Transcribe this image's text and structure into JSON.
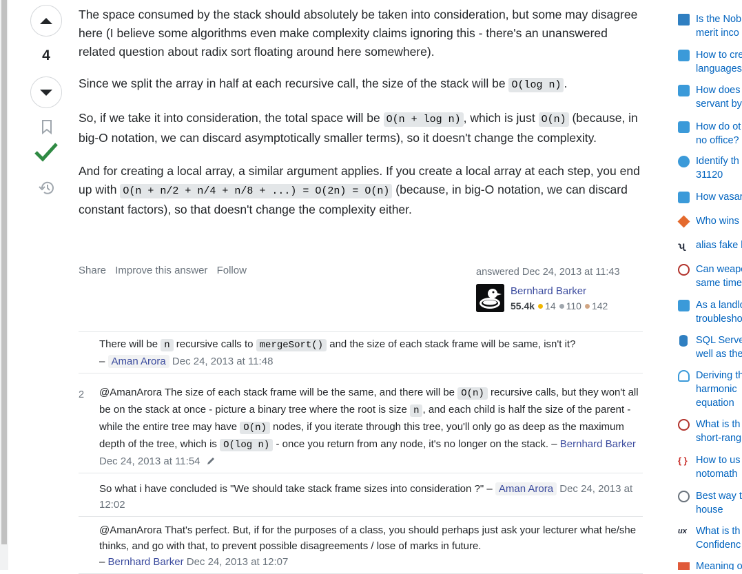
{
  "vote": {
    "score": "4"
  },
  "post": {
    "p1": "The space consumed by the stack should absolutely be taken into consideration, but some may disagree here (I believe some algorithms even make complexity claims ignoring this - there's an unanswered related question about radix sort floating around here somewhere).",
    "p2_a": "Since we split the array in half at each recursive call, the size of the stack will be ",
    "p2_code": "O(log n)",
    "p2_b": ".",
    "p3_a": "So, if we take it into consideration, the total space will be ",
    "p3_code1": "O(n + log n)",
    "p3_b": ", which is just ",
    "p3_code2": "O(n)",
    "p3_c": " (because, in big-O notation, we can discard asymptotically smaller terms), so it doesn't change the complexity.",
    "p4_a": "And for creating a local array, a similar argument applies. If you create a local array at each step, you end up with ",
    "p4_code": "O(n + n/2 + n/4 + n/8 + ...) = O(2n) = O(n)",
    "p4_b": " (because, in big-O notation, we can discard constant factors), so that doesn't change the complexity either."
  },
  "menu": {
    "share": "Share",
    "improve": "Improve this answer",
    "follow": "Follow"
  },
  "signature": {
    "action": "answered Dec 24, 2013 at 11:43",
    "user": "Bernhard Barker",
    "rep": "55.4k",
    "gold": "14",
    "silver": "110",
    "bronze": "142",
    "colors": {
      "gold": "#f1b600",
      "silver": "#9fa6ad",
      "bronze": "#d1a684"
    }
  },
  "comments": [
    {
      "score": "",
      "t1": "There will be ",
      "c1": "n",
      "t2": " recursive calls to ",
      "c2": "mergeSort()",
      "t3": " and the size of each stack frame will be same, isn't it?",
      "dash": " – ",
      "user": "Aman Arora",
      "date": "Dec 24, 2013 at 11:48"
    },
    {
      "score": "2",
      "t1": "@AmanArora The size of each stack frame will be the same, and there will be ",
      "c1": "O(n)",
      "t2": " recursive calls, but they won't all be on the stack at once - picture a binary tree where the root is size ",
      "c2": "n",
      "t3": ", and each child is half the size of the parent - while the entire tree may have ",
      "c3": "O(n)",
      "t4": " nodes, if you iterate through this tree, you'll only go as deep as the maximum depth of the tree, which is ",
      "c4": "O(log n)",
      "t5": " - once you return from any node, it's no longer on the stack.",
      "dash": " – ",
      "user": "Bernhard Barker",
      "date": "Dec 24, 2013 at 11:54"
    },
    {
      "score": "",
      "t1": "So what i have concluded is \"We should take stack frame sizes into consideration ?\"",
      "dash": " – ",
      "user": "Aman Arora",
      "date": "Dec 24, 2013 at 12:02"
    },
    {
      "score": "",
      "t1": "@AmanArora That's perfect. But, if for the purposes of a class, you should perhaps just ask your lecturer what he/she thinks, and go with that, to prevent possible disagreements / lose of marks in future.",
      "dash": "– ",
      "user": "Bernhard Barker",
      "date": "Dec 24, 2013 at 12:07"
    }
  ],
  "sidebar": [
    {
      "text": "Is the Nob",
      "text2": "merit inco",
      "icon": "worldbuilding-icon",
      "color": "#2f7fc1"
    },
    {
      "text": "How to cre",
      "text2": "languages",
      "icon": "softwareengineering-icon",
      "color": "#3b9ad9"
    },
    {
      "text": "How does",
      "text2": "servant by",
      "icon": "politics-icon",
      "color": "#3b9ad9"
    },
    {
      "text": "How do ot",
      "text2": "no office?",
      "icon": "law-icon",
      "color": "#3b9ad9"
    },
    {
      "text": "Identify th",
      "text2": "31120",
      "icon": "puzzling-icon",
      "color": "#3b9ad9"
    },
    {
      "text": "How vasar",
      "text2": "",
      "icon": "hinduism-icon",
      "color": "#3b9ad9"
    },
    {
      "text": "Who wins",
      "text2": "",
      "icon": "boardgames-icon",
      "color": "#e46a2d"
    },
    {
      "text": "alias fake l",
      "text2": "",
      "icon": "unix-icon",
      "color": "#1d2536"
    },
    {
      "text": "Can weapo",
      "text2": "same time",
      "icon": "rpg-icon",
      "color": "#b2332c"
    },
    {
      "text": "As a landlo",
      "text2": "troublesho",
      "icon": "law-icon",
      "color": "#3b9ad9"
    },
    {
      "text": "SQL Serve",
      "text2": "well as the",
      "icon": "dba-icon",
      "color": "#2f7fc1"
    },
    {
      "text": "Deriving th",
      "text2": "harmonic",
      "text3": "equation",
      "icon": "physics-icon",
      "color": "#3b9ad9"
    },
    {
      "text": "What is th",
      "text2": "short-rang",
      "icon": "chemistry-icon",
      "color": "#b2332c"
    },
    {
      "text": "How to us",
      "text2": "notomath",
      "icon": "tex-icon",
      "color": "#c9302c"
    },
    {
      "text": "Best way t",
      "text2": "house",
      "icon": "diy-icon",
      "color": "#6a737c"
    },
    {
      "text": "What is th",
      "text2": "Confidenc",
      "icon": "ux-icon",
      "color": "#1d2536"
    },
    {
      "text": "Meaning o",
      "text2": "",
      "icon": "english-icon",
      "color": "#e05a3a"
    }
  ]
}
